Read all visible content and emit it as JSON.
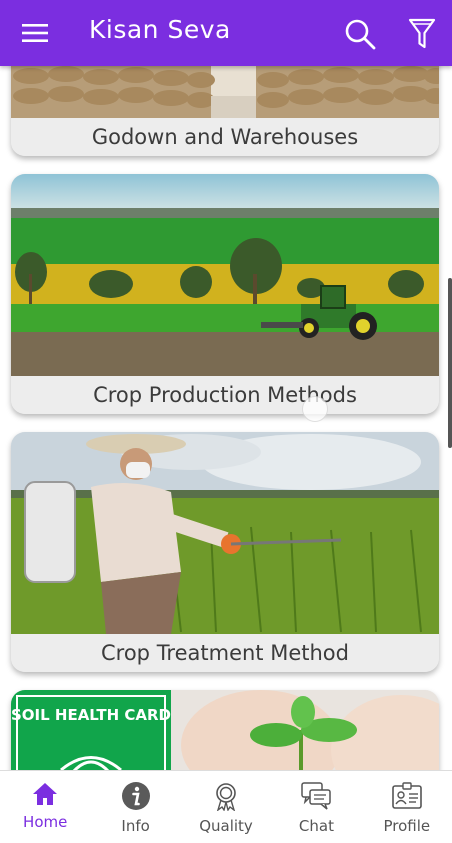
{
  "appbar": {
    "title": "Kisan Seva",
    "menu_icon": "hamburger-menu-icon",
    "search_icon": "search-icon",
    "filter_icon": "filter-icon"
  },
  "colors": {
    "primary": "#7b2ee0",
    "card_label_bg": "#ededed",
    "text_dark": "#3b3b3b",
    "nav_inactive": "#555555"
  },
  "cards": [
    {
      "label": "Godown and Warehouses",
      "image": "warehouse-grain-sacks"
    },
    {
      "label": "Crop Production Methods",
      "image": "tractor-in-green-fields"
    },
    {
      "label": "Crop Treatment Method",
      "image": "farmer-spraying-crops"
    },
    {
      "label": "",
      "image": "soil-health-card-seedling",
      "image_text": "SOIL HEALTH CARD"
    }
  ],
  "bottom_nav": [
    {
      "label": "Home",
      "icon": "home-icon",
      "active": true
    },
    {
      "label": "Info",
      "icon": "info-icon",
      "active": false
    },
    {
      "label": "Quality",
      "icon": "quality-badge-icon",
      "active": false
    },
    {
      "label": "Chat",
      "icon": "chat-icon",
      "active": false
    },
    {
      "label": "Profile",
      "icon": "profile-card-icon",
      "active": false
    }
  ]
}
